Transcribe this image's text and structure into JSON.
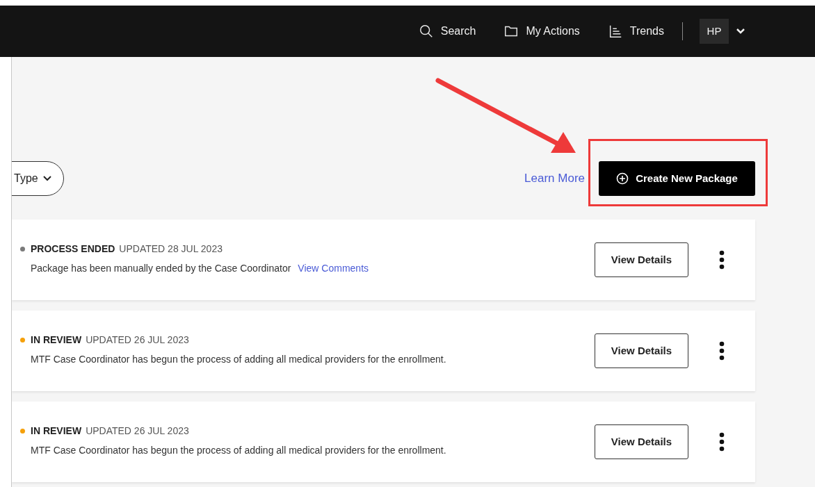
{
  "nav": [
    {
      "kind": "search",
      "label": "Search"
    },
    {
      "kind": "folder",
      "label": "My Actions"
    },
    {
      "kind": "trends",
      "label": "Trends"
    }
  ],
  "user": {
    "initials": "HP"
  },
  "filter": {
    "label": "Type"
  },
  "learn_more": "Learn More",
  "create_button": {
    "label": "Create New Package"
  },
  "packages": [
    {
      "status": "PROCESS ENDED",
      "color": "#7a7a7a",
      "updated": "UPDATED 28 JUL 2023",
      "description": "Package has been manually ended by the Case Coordinator",
      "link": "View Comments",
      "button": "View Details"
    },
    {
      "status": "IN REVIEW",
      "color": "#f5a00a",
      "updated": "UPDATED 26 JUL 2023",
      "description": "MTF Case Coordinator has begun the process of adding all medical providers for the enrollment.",
      "button": "View Details"
    },
    {
      "status": "IN REVIEW",
      "color": "#f5a00a",
      "updated": "UPDATED 26 JUL 2023",
      "description": "MTF Case Coordinator has begun the process of adding all medical providers for the enrollment.",
      "button": "View Details"
    }
  ]
}
